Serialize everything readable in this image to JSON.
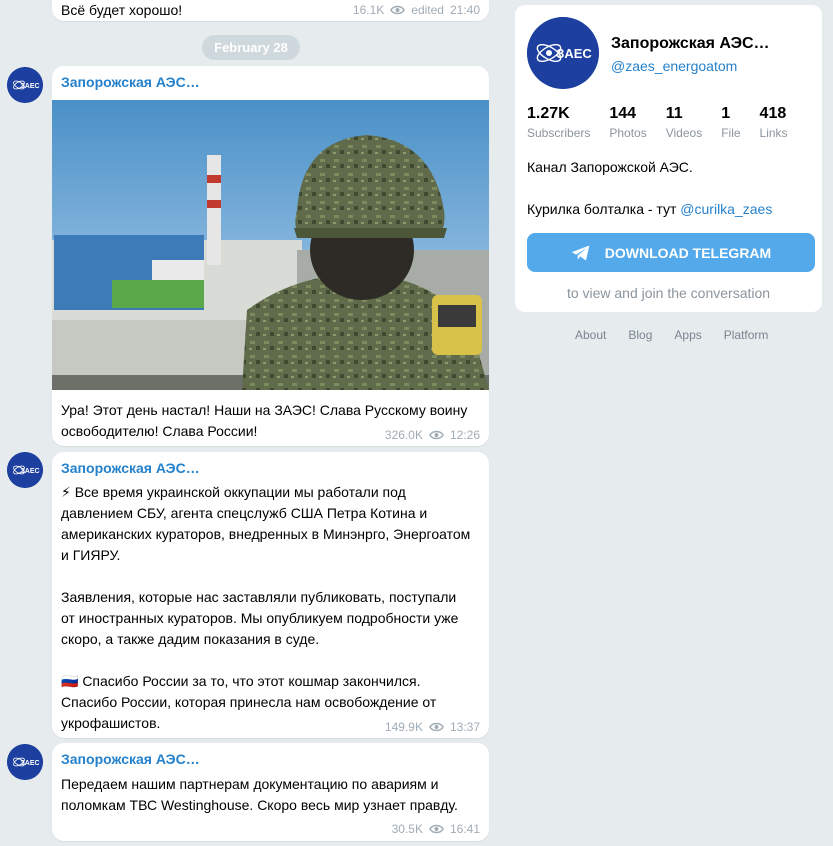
{
  "feed": {
    "top_message": {
      "text": "Всё будет хорошо!",
      "views": "16.1K",
      "edited": "edited",
      "time": "21:40"
    },
    "date_separator": "February 28",
    "posts": [
      {
        "author": "Запорожская АЭС…",
        "avatar_label": "ЗАЕС",
        "text": "Ура! Этот день настал! Наши на ЗАЭС! Слава Русскому воину\nосвободителю! Слава России!",
        "views": "326.0K",
        "time": "12:26"
      },
      {
        "author": "Запорожская АЭС…",
        "avatar_label": "ЗАЕС",
        "text": "⚡ Все время украинской оккупации мы работали под\nдавлением СБУ, агента спецслужб США Петра Котина и\nамериканских кураторов, внедренных в Минэнрго, Энергоатом\nи ГИЯРУ.\n\nЗаявления, которые нас заставляли публиковать, поступали\nот иностранных кураторов. Мы опубликуем подробности уже\nскоро, а также дадим показания в суде.\n\n🇷🇺 Спасибо России за то, что этот кошмар закончился.\nСпасибо России, которая принесла нам освобождение от\nукрофашистов.",
        "views": "149.9K",
        "time": "13:37"
      },
      {
        "author": "Запорожская АЭС…",
        "avatar_label": "ЗАЕС",
        "text": "Передаем нашим партнерам документацию по авариям и\nполомкам ТВС Westinghouse. Скоро весь мир узнает правду.",
        "views": "30.5K",
        "time": "16:41"
      }
    ]
  },
  "channel": {
    "title": "Запорожская АЭС…",
    "handle": "@zaes_energoatom",
    "avatar_label": "ЗАЕС",
    "stats": [
      {
        "num": "1.27K",
        "label": "Subscribers"
      },
      {
        "num": "144",
        "label": "Photos"
      },
      {
        "num": "11",
        "label": "Videos"
      },
      {
        "num": "1",
        "label": "File"
      },
      {
        "num": "418",
        "label": "Links"
      }
    ],
    "description": "Канал Запорожской АЭС.",
    "chat_text": "Курилка болталка - тут ",
    "chat_link": "@curilka_zaes",
    "download_label": "DOWNLOAD TELEGRAM",
    "join_hint": "to view and join the conversation"
  },
  "footer": {
    "links": [
      "About",
      "Blog",
      "Apps",
      "Platform"
    ]
  },
  "colors": {
    "accent": "#2481cc",
    "button": "#54a9eb",
    "background": "#e6ebee",
    "avatar": "#1c3fa0"
  },
  "icons": {
    "views": "eye-icon",
    "download": "telegram-plane-icon"
  }
}
